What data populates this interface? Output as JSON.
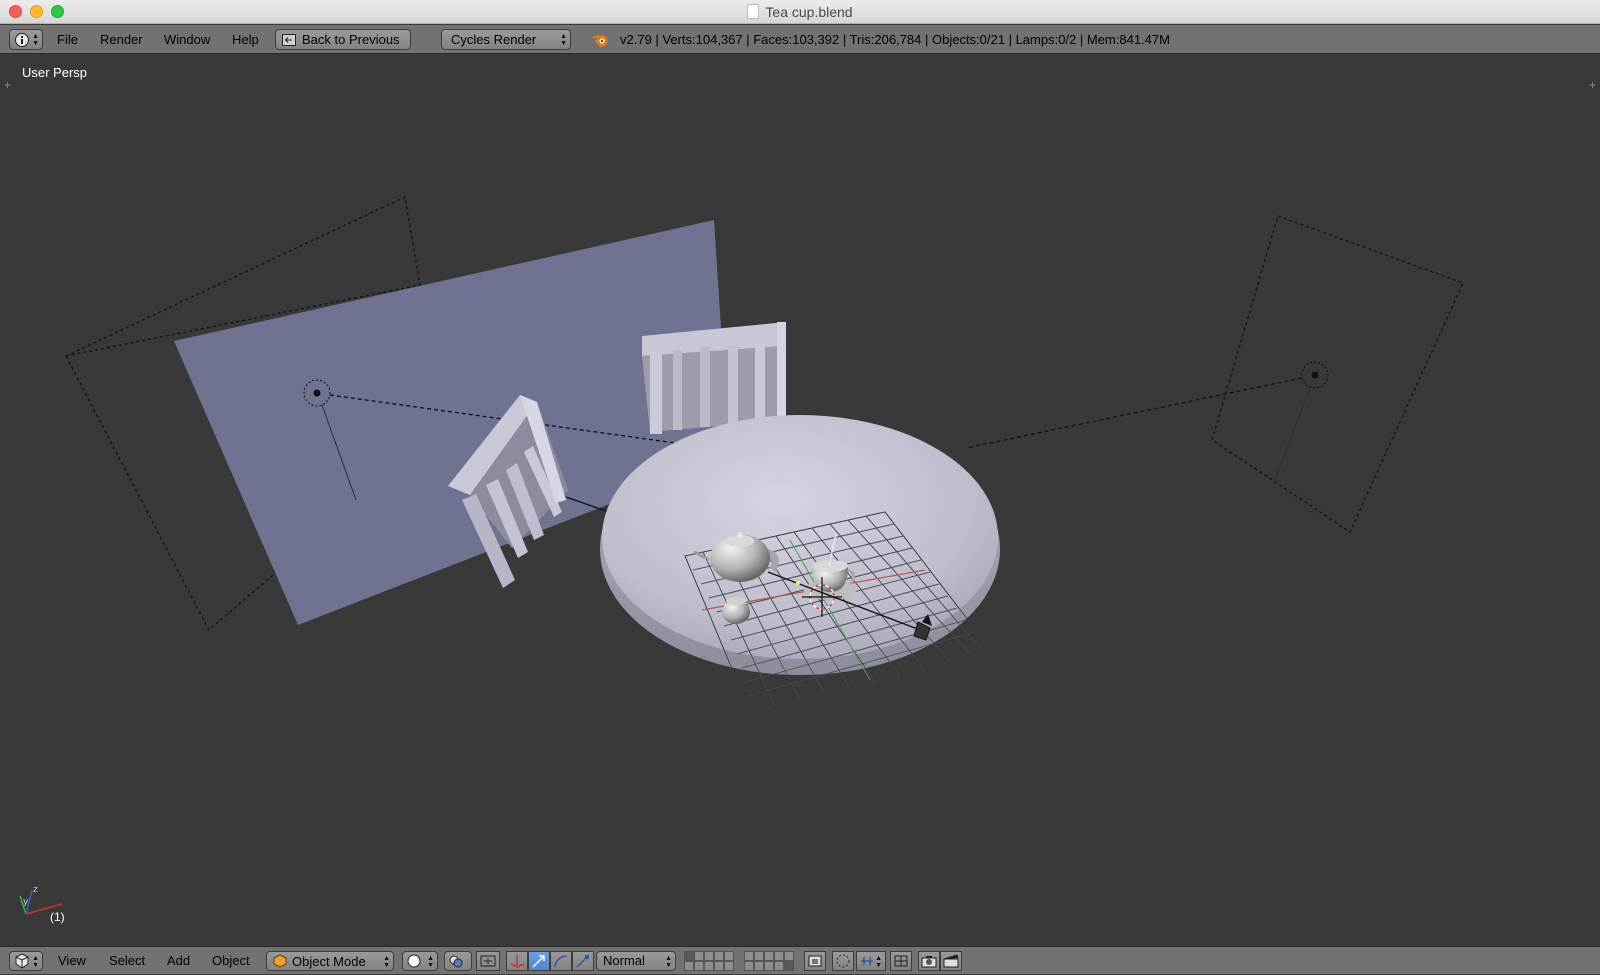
{
  "window": {
    "title": "Tea cup.blend"
  },
  "info_header": {
    "editor_icon": "info-icon",
    "menus": [
      "File",
      "Render",
      "Window",
      "Help"
    ],
    "back_button": "Back to Previous",
    "render_engine": "Cycles Render",
    "blender_logo": "blender-logo-icon",
    "stats": "v2.79 | Verts:104,367 | Faces:103,392 | Tris:206,784 | Objects:0/21 | Lamps:0/2 | Mem:841.47M"
  },
  "viewport": {
    "label": "User Persp",
    "frame": "(1)",
    "objects": [
      "backdrop-plane",
      "chair-left",
      "chair-back",
      "round-table",
      "teapot",
      "teacup",
      "sugar-bowl",
      "camera",
      "area-lamp-left",
      "area-lamp-right",
      "grid-floor"
    ]
  },
  "view3d_header": {
    "editor_icon": "3d-view-icon",
    "menus": [
      "View",
      "Select",
      "Add",
      "Object"
    ],
    "mode": "Object Mode",
    "pivot": "Normal"
  },
  "colors": {
    "viewport_bg": "#393939",
    "header_bg": "#727272",
    "plane": "#6f7290",
    "table_top": "#c6c6d6",
    "accent_blue": "#5680c2"
  }
}
